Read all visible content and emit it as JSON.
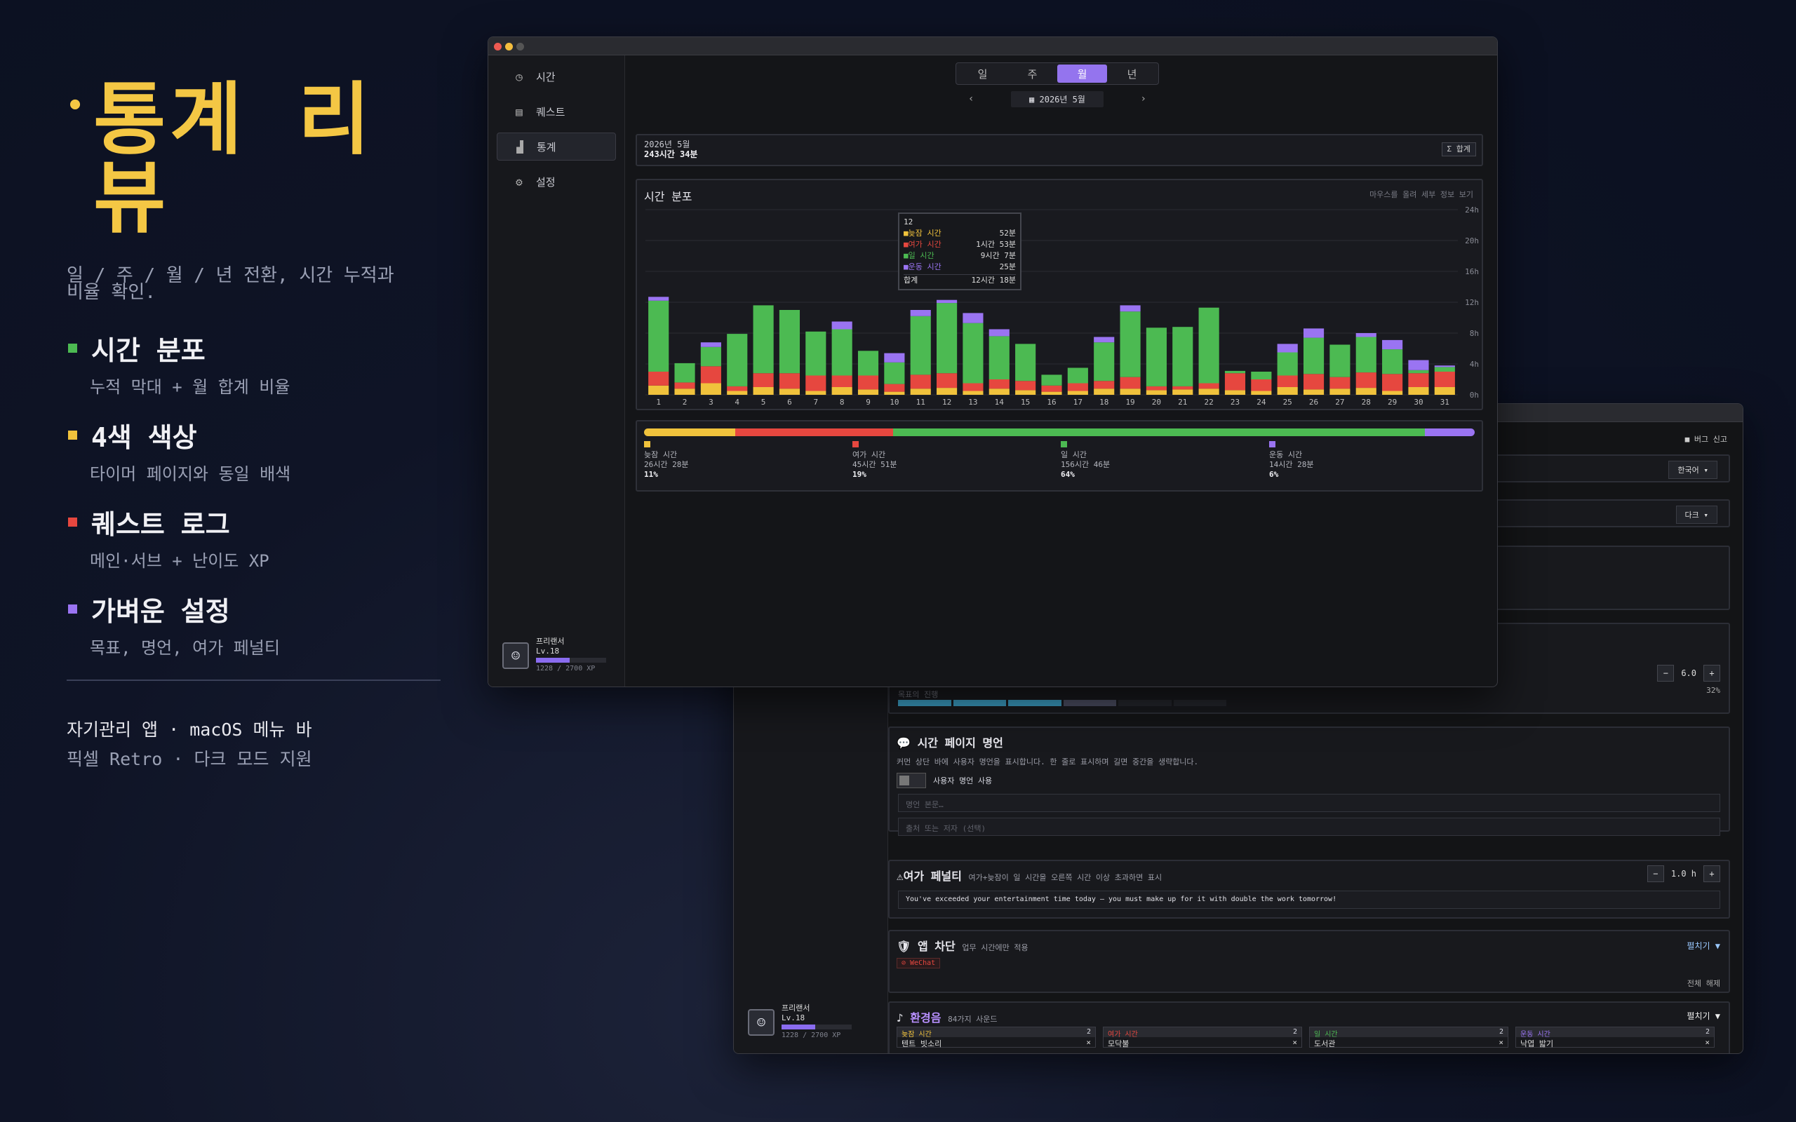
{
  "hero": {
    "title": "통계 리뷰",
    "subtitle": "일 / 주 / 월 / 년 전환, 시간 누적과 비율 확인.",
    "features": [
      {
        "title": "시간 분포",
        "desc": "누적 막대 + 월 합계 비율",
        "color": "#4cba52"
      },
      {
        "title": "4색 색상",
        "desc": "타이머 페이지와 동일 배색",
        "color": "#f0c23c"
      },
      {
        "title": "퀘스트 로그",
        "desc": "메인·서브 + 난이도 XP",
        "color": "#e6473f"
      },
      {
        "title": "가벼운 설정",
        "desc": "목표, 명언, 여가 페널티",
        "color": "#9a74f2"
      }
    ],
    "footer1": "자기관리 앱 · macOS 메뉴 바",
    "footer2": "픽셀 Retro · 다크 모드 지원"
  },
  "colors": {
    "sleep": "#f0c23c",
    "leisure": "#e6473f",
    "work": "#4cba52",
    "exercise": "#9a74f2",
    "accent": "#9474ee"
  },
  "sidebar": {
    "items": [
      {
        "label": "시간",
        "icon": "clock-icon"
      },
      {
        "label": "퀘스트",
        "icon": "calendar-check-icon"
      },
      {
        "label": "통계",
        "icon": "bar-chart-icon"
      },
      {
        "label": "설정",
        "icon": "gear-icon"
      }
    ],
    "profile": {
      "name": "프리랜서",
      "level": "Lv.18",
      "xp": "1228 / 2700 XP",
      "xp_fraction": 0.48
    }
  },
  "period": {
    "tabs": [
      "일",
      "주",
      "월",
      "년"
    ],
    "active": 2,
    "prev": "‹",
    "next": "›",
    "date": "▦ 2026년 5월"
  },
  "summary": {
    "month": "2026년 5월",
    "total": "243시간 34분",
    "button": "Σ 합계"
  },
  "chart": {
    "title": "시간 분포",
    "hint": "마우스를 올려 세부 정보 보기"
  },
  "chart_data": {
    "type": "bar",
    "stacked": true,
    "categories": [
      "1",
      "2",
      "3",
      "4",
      "5",
      "6",
      "7",
      "8",
      "9",
      "10",
      "11",
      "12",
      "13",
      "14",
      "15",
      "16",
      "17",
      "18",
      "19",
      "20",
      "21",
      "22",
      "23",
      "24",
      "25",
      "26",
      "27",
      "28",
      "29",
      "30",
      "31"
    ],
    "yticks": [
      "0h",
      "4h",
      "8h",
      "12h",
      "16h",
      "20h",
      "24h"
    ],
    "ylim": [
      0,
      24
    ],
    "series": [
      {
        "name": "늦잠 시간",
        "color": "#f0c23c",
        "values": [
          1.2,
          0.8,
          1.5,
          0.5,
          1.0,
          0.8,
          0.5,
          1.0,
          0.7,
          0.4,
          0.8,
          0.9,
          0.5,
          0.8,
          0.6,
          0.4,
          0.5,
          0.8,
          0.8,
          0.6,
          0.7,
          0.8,
          0.6,
          0.5,
          1.0,
          0.7,
          0.8,
          0.9,
          0.5,
          1.0,
          1.0
        ]
      },
      {
        "name": "여가 시간",
        "color": "#e6473f",
        "values": [
          1.8,
          0.8,
          2.2,
          0.6,
          1.8,
          2.0,
          2.0,
          1.5,
          1.8,
          1.0,
          1.8,
          1.9,
          1.0,
          1.2,
          1.2,
          0.8,
          1.0,
          1.0,
          1.5,
          0.5,
          0.4,
          0.7,
          2.2,
          1.5,
          1.5,
          2.0,
          1.5,
          2.0,
          2.2,
          1.8,
          2.0
        ]
      },
      {
        "name": "일 시간",
        "color": "#4cba52",
        "values": [
          9.2,
          2.5,
          2.5,
          6.8,
          8.8,
          8.2,
          5.7,
          6.0,
          3.2,
          2.8,
          7.6,
          9.1,
          7.8,
          5.6,
          4.8,
          1.4,
          2.0,
          5.0,
          8.5,
          7.6,
          7.7,
          9.8,
          0.3,
          1.0,
          3.0,
          4.7,
          4.2,
          4.6,
          3.2,
          0.4,
          0.6
        ]
      },
      {
        "name": "운동 시간",
        "color": "#9a74f2",
        "values": [
          0.5,
          0,
          0.6,
          0,
          0,
          0,
          0,
          1.0,
          0,
          1.2,
          0.8,
          0.4,
          1.3,
          0.9,
          0,
          0,
          0,
          0.7,
          0.8,
          0,
          0,
          0,
          0,
          0,
          1.1,
          1.2,
          0,
          0.5,
          1.2,
          1.3,
          0.2
        ]
      }
    ]
  },
  "tooltip": {
    "day": "12",
    "rows": [
      {
        "label": "늦잠 시간",
        "value": "52분",
        "color": "#f0c23c"
      },
      {
        "label": "여가 시간",
        "value": "1시간 53분",
        "color": "#e6473f"
      },
      {
        "label": "일 시간",
        "value": "9시간 7분",
        "color": "#4cba52"
      },
      {
        "label": "운동 시간",
        "value": "25분",
        "color": "#9a74f2"
      }
    ],
    "total_label": "합계",
    "total_value": "12시간 18분"
  },
  "breakdown": [
    {
      "label": "늦잠 시간",
      "time": "26시간 28분",
      "pct": "11%",
      "fraction": 0.11,
      "color": "#f0c23c"
    },
    {
      "label": "여가 시간",
      "time": "45시간 51분",
      "pct": "19%",
      "fraction": 0.19,
      "color": "#e6473f"
    },
    {
      "label": "일 시간",
      "time": "156시간 46분",
      "pct": "64%",
      "fraction": 0.64,
      "color": "#4cba52"
    },
    {
      "label": "운동 시간",
      "time": "14시간 28분",
      "pct": "6%",
      "fraction": 0.06,
      "color": "#9a74f2"
    }
  ],
  "settings": {
    "bug_report": "■ 버그 신고",
    "language": "한국어 ▾",
    "theme": "다크 ▾",
    "goal_value": "6.0",
    "goal_pct": "32%",
    "goal_label": "목표의 진행",
    "quote": {
      "title": "시간 페이지 명언",
      "desc": "커먼 상단 바에 사용자 명언을 표시합니다. 한 줄로 표시하며 길면 중간을 생략합니다.",
      "toggle": "사용자 명언 사용",
      "ph1": "명언 본문…",
      "ph2": "출처 또는 저자 (선택)"
    },
    "penalty": {
      "title": "여가 페널티",
      "desc": "여가+늦잠이 일 시간을 오른쪽 시간 이상 초과하면 표시",
      "value": "1.0 h",
      "message": "You've exceeded your entertainment time today — you must make up for it with double the work tomorrow!"
    },
    "block": {
      "title": "앱 차단",
      "desc": "업무 시간에만 적용",
      "expand": "펼치기 ▼",
      "chip": "⊘ WeChat",
      "clear": "전체 해제"
    },
    "ambient": {
      "title": "환경음",
      "desc": "84가지 사운드",
      "expand": "펼치기 ▼",
      "cols": [
        {
          "label": "늦잠 시간",
          "n": "2",
          "item": "텐트 빗소리",
          "color": "#f0c23c"
        },
        {
          "label": "여가 시간",
          "n": "2",
          "item": "모닥불",
          "color": "#e6473f"
        },
        {
          "label": "일 시간",
          "n": "2",
          "item": "도서관",
          "color": "#4cba52"
        },
        {
          "label": "운동 시간",
          "n": "2",
          "item": "낙엽 밟기",
          "color": "#9a74f2"
        }
      ]
    }
  }
}
